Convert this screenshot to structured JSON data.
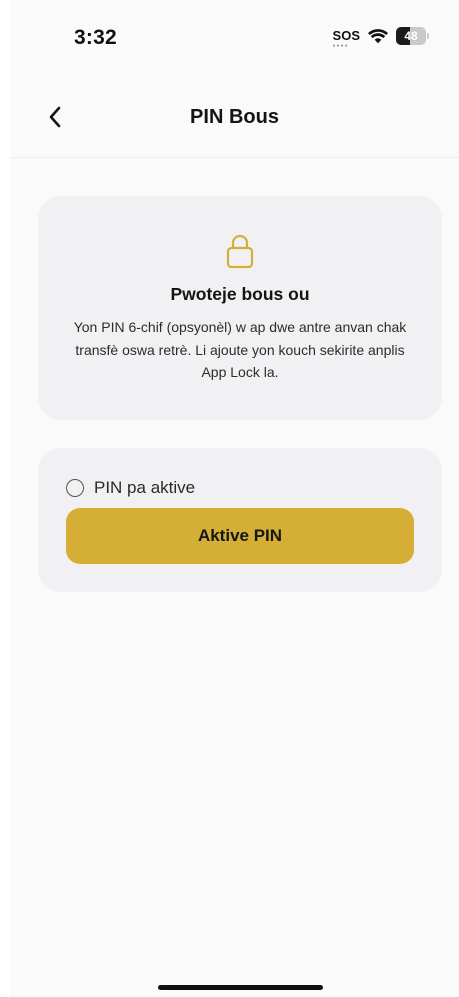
{
  "status_bar": {
    "time": "3:32",
    "sos": "SOS",
    "battery": "48",
    "battery_level_percent": 48
  },
  "header": {
    "title": "PIN Bous",
    "back_icon": "chevron-left-icon"
  },
  "info_card": {
    "icon": "lock-icon",
    "title": "Pwoteje bous ou",
    "body": "Yon PIN 6-chif (opsyonèl) w ap dwe antre anvan chak transfè oswa retrè. Li ajoute yon kouch sekirite anplis App Lock la."
  },
  "pin_card": {
    "status_label": "PIN pa aktive",
    "status_active": false,
    "activate_button_label": "Aktive PIN"
  },
  "colors": {
    "accent": "#d4ae35",
    "card_background": "#f1f1f3",
    "page_background": "#fafafa"
  }
}
